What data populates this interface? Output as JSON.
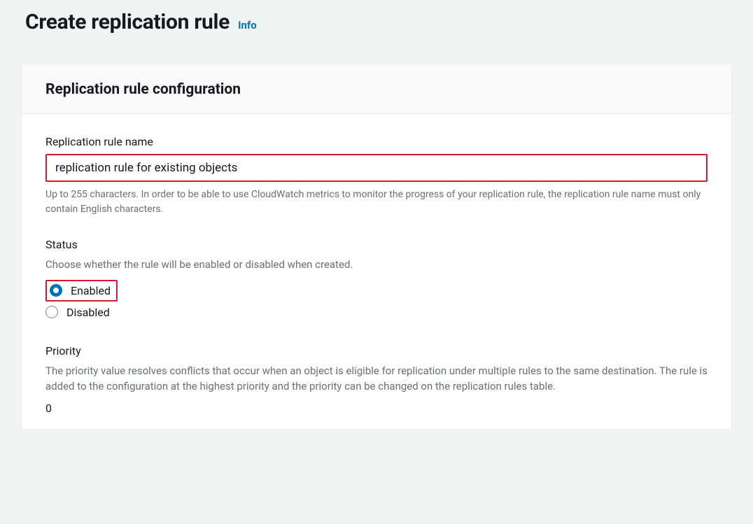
{
  "header": {
    "title": "Create replication rule",
    "info_label": "Info"
  },
  "panel": {
    "title": "Replication rule configuration"
  },
  "rule_name": {
    "label": "Replication rule name",
    "value": "replication rule for existing objects",
    "help": "Up to 255 characters. In order to be able to use CloudWatch metrics to monitor the progress of your replication rule, the replication rule name must only contain English characters."
  },
  "status": {
    "label": "Status",
    "description": "Choose whether the rule will be enabled or disabled when created.",
    "options": {
      "enabled": "Enabled",
      "disabled": "Disabled"
    },
    "selected": "enabled"
  },
  "priority": {
    "label": "Priority",
    "description": "The priority value resolves conflicts that occur when an object is eligible for replication under multiple rules to the same destination. The rule is added to the configuration at the highest priority and the priority can be changed on the replication rules table.",
    "value": "0"
  }
}
